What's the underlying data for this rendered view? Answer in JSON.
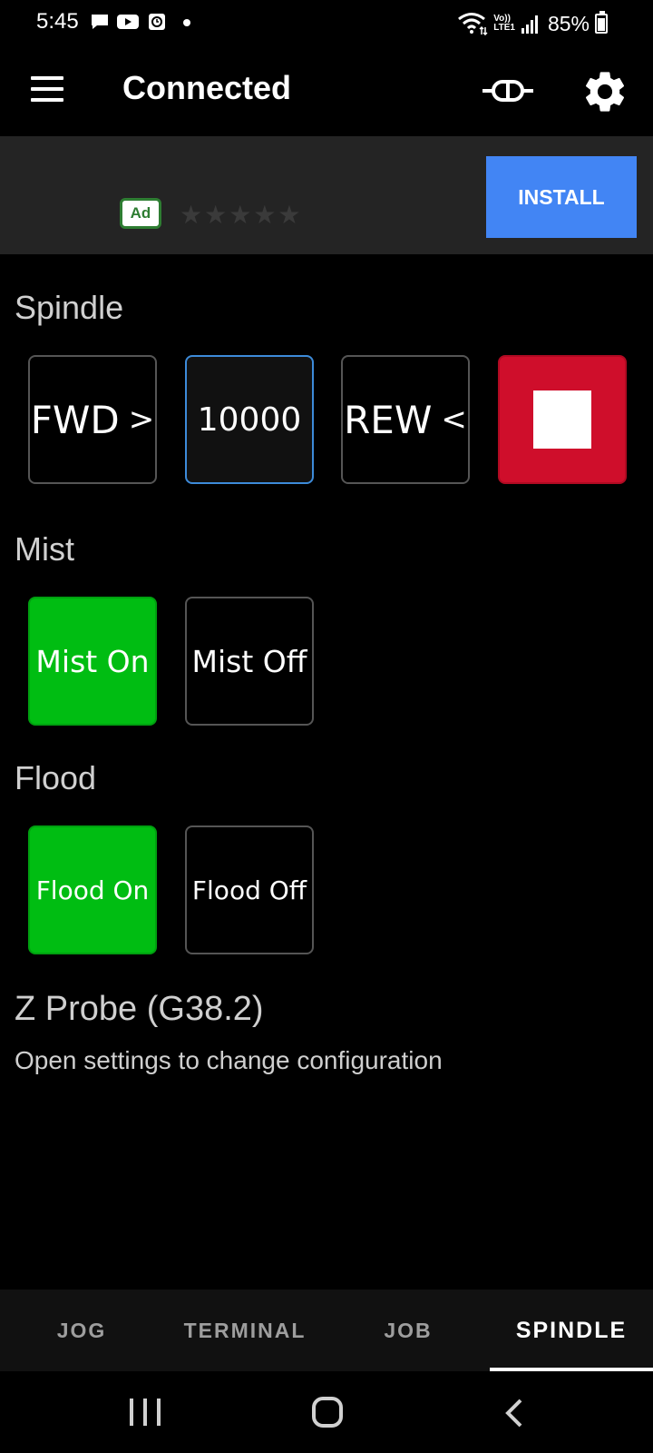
{
  "status_bar": {
    "time": "5:45",
    "battery": "85%",
    "battery_level": 0.85,
    "icons": [
      "chat-icon",
      "youtube-icon",
      "clock-app-icon",
      "wifi-icon",
      "volte-icon",
      "signal-icon",
      "battery-icon"
    ],
    "network_label_top": "Vo))",
    "network_label_bottom": "LTE1"
  },
  "toolbar": {
    "title": "Connected",
    "menu_icon": "hamburger-icon",
    "connect_icon": "connection-plug-icon",
    "settings_icon": "gear-icon"
  },
  "ad": {
    "badge": "Ad",
    "stars": "★★★★★",
    "install_label": "INSTALL",
    "install_color": "#4285f4"
  },
  "spindle": {
    "label": "Spindle",
    "fwd_label": "FWD",
    "fwd_chevron": ">",
    "rpm": "10000",
    "rew_label": "REW",
    "rew_chevron": "<",
    "stop_color": "#cf0e2b"
  },
  "mist": {
    "label": "Mist",
    "on_label": "Mist On",
    "off_label": "Mist Off",
    "active_color": "#00bd12"
  },
  "flood": {
    "label": "Flood",
    "on_label": "Flood On",
    "off_label": "Flood Off"
  },
  "probe": {
    "title": "Z Probe (G38.2)",
    "hint": "Open settings to change configuration"
  },
  "tabs": [
    {
      "label": "JOG",
      "active": false
    },
    {
      "label": "TERMINAL",
      "active": false
    },
    {
      "label": "JOB",
      "active": false
    },
    {
      "label": "SPINDLE",
      "active": true
    }
  ]
}
